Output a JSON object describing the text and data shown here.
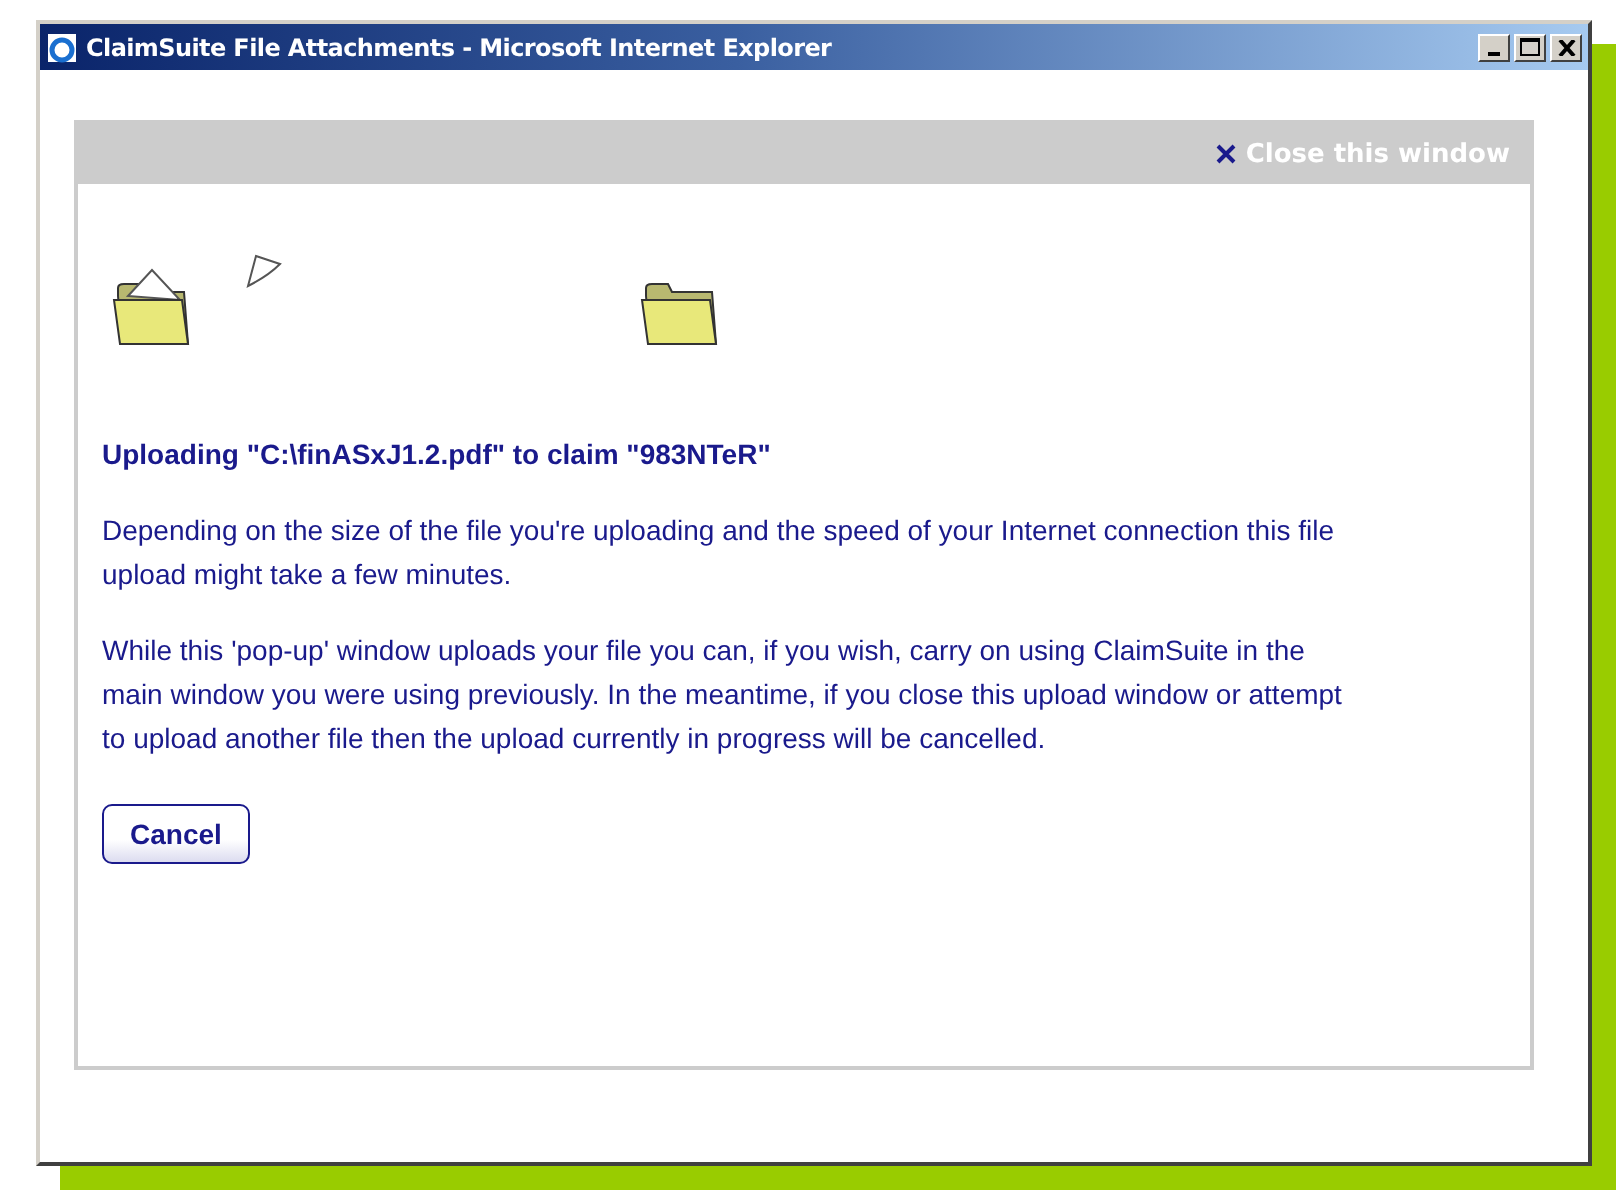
{
  "window": {
    "title": "ClaimSuite File Attachments - Microsoft Internet Explorer"
  },
  "header": {
    "close_link": "Close this window"
  },
  "heading": "Uploading \"C:\\finASxJ1.2.pdf\" to claim \"983NTeR\"",
  "paragraphs": [
    "Depending on the size of the file you're uploading and the speed of your Internet connection this file upload might take a few minutes.",
    "While this 'pop-up' window uploads your file you can, if you wish, carry on using ClaimSuite in the main window you were using previously. In the meantime, if you close this upload window or attempt to upload another file then the upload currently in progress will be cancelled."
  ],
  "buttons": [
    "Cancel"
  ]
}
